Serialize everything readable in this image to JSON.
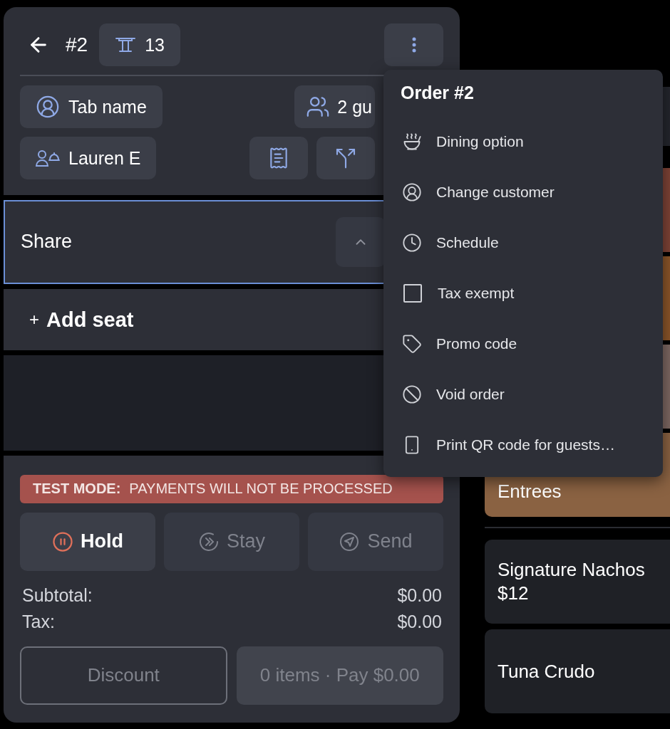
{
  "header": {
    "order_number": "#2",
    "table": "13"
  },
  "customer": {
    "tab_name": "Tab name",
    "guests": "2 gu",
    "server": "Lauren E"
  },
  "seats": [
    {
      "label": "Share",
      "selected": true,
      "expanded": true
    }
  ],
  "add_seat": {
    "icon": "+",
    "label": "Add seat"
  },
  "banner": {
    "label": "TEST MODE:",
    "message": "PAYMENTS WILL NOT BE PROCESSED"
  },
  "actions": [
    {
      "kind": "hold",
      "label": "Hold",
      "disabled": false
    },
    {
      "kind": "stay",
      "label": "Stay",
      "disabled": true
    },
    {
      "kind": "send",
      "label": "Send",
      "disabled": true
    }
  ],
  "totals": [
    {
      "label": "Subtotal:",
      "value": "$0.00"
    },
    {
      "label": "Tax:",
      "value": "$0.00"
    }
  ],
  "footer_buttons": [
    {
      "kind": "outline",
      "label": "Discount",
      "disabled": true
    },
    {
      "kind": "filled",
      "label": "0 items · Pay $0.00",
      "disabled": true
    }
  ],
  "menu": {
    "title": "Order #2",
    "items": [
      {
        "kind": "dining",
        "label": "Dining option"
      },
      {
        "kind": "customer",
        "label": "Change customer"
      },
      {
        "kind": "schedule",
        "label": "Schedule"
      },
      {
        "kind": "checkbox",
        "label": "Tax exempt",
        "checked": false
      },
      {
        "kind": "promo",
        "label": "Promo code"
      },
      {
        "kind": "void",
        "label": "Void order"
      },
      {
        "kind": "qr",
        "label": "Print QR code for guests…"
      }
    ]
  },
  "categories": [
    {
      "color": "#24262d"
    },
    {
      "color": "#7e4336"
    },
    {
      "color": "#8b5529"
    },
    {
      "color": "#7d6862"
    },
    {
      "color": "#8a6242",
      "label": "Entrees"
    }
  ],
  "items": [
    {
      "name": "Signature Nachos",
      "price": "$12"
    },
    {
      "name": "Tuna Crudo"
    }
  ]
}
